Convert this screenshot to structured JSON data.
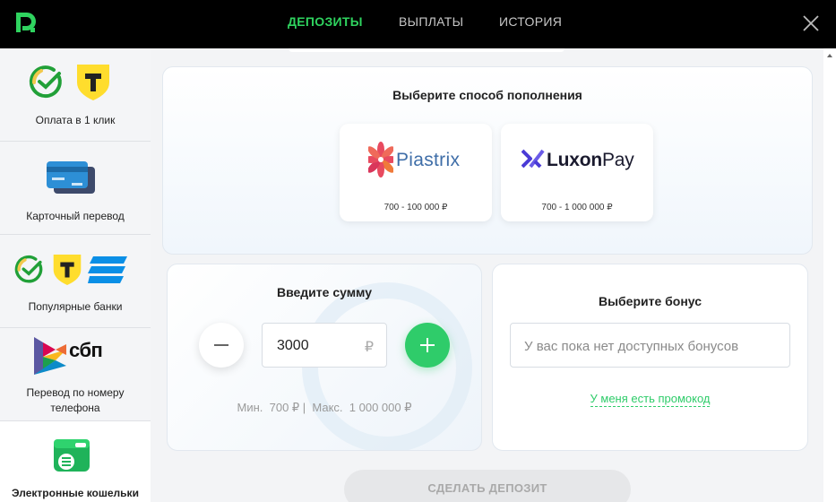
{
  "header": {
    "tabs": [
      {
        "label": "ДЕПОЗИТЫ",
        "active": true
      },
      {
        "label": "ВЫПЛАТЫ",
        "active": false
      },
      {
        "label": "ИСТОРИЯ",
        "active": false
      }
    ],
    "accent_color": "#2fd35f"
  },
  "sidebar": {
    "items": [
      {
        "label": "Оплата в 1 клик",
        "icons": [
          "sber-check-icon",
          "tbank-shield-icon"
        ]
      },
      {
        "label": "Карточный перевод",
        "icons": [
          "bank-cards-icon"
        ]
      },
      {
        "label": "Популярные банки",
        "icons": [
          "sber-check-icon",
          "tbank-shield-icon",
          "vtb-stripes-icon"
        ]
      },
      {
        "label_line1": "Перевод по номеру",
        "label_line2": "телефона",
        "logo_text": "сбп",
        "icons": [
          "sbp-logo-icon"
        ]
      },
      {
        "label": "Электронные кошельки",
        "icons": [
          "wallet-icon"
        ],
        "active": true
      }
    ]
  },
  "method_panel": {
    "title": "Выберите способ пополнения",
    "methods": [
      {
        "logo_text": "Piastrix",
        "range": "700 - 100 000 ₽"
      },
      {
        "logo_text_bold": "Luxon",
        "logo_text_light": "Pay",
        "range": "700 - 1 000 000 ₽"
      }
    ]
  },
  "amount_panel": {
    "title": "Введите сумму",
    "value": "3000",
    "currency": "₽",
    "limits": "Мин.  700 ₽ |  Макс.  1 000 000 ₽"
  },
  "bonus_panel": {
    "title": "Выберите бонус",
    "placeholder": "У вас пока нет доступных бонусов",
    "promo_link": "У меня есть промокод"
  },
  "deposit_button": "СДЕЛАТЬ ДЕПОЗИТ",
  "colors": {
    "green": "#2fcc6a",
    "header_bg": "#000000",
    "sidebar_bg": "#f4f5f7"
  }
}
